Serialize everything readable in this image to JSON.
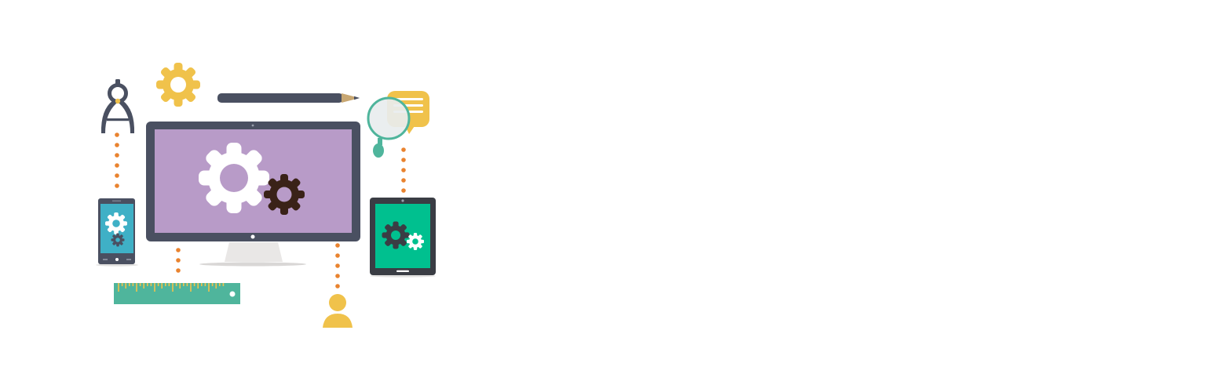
{
  "illustration": {
    "colors": {
      "dark_slate": "#4a5061",
      "monitor_screen": "#b89bc8",
      "gear_yellow": "#f0c24b",
      "dots_orange": "#e9832f",
      "teal": "#4fb59c",
      "phone_screen": "#3fb0c6",
      "tablet_screen": "#00c08f",
      "gear_dark_brown": "#3a2218",
      "pencil_tip": "#c8a772",
      "stand_light": "#e9e7e6",
      "magnifier_lens": "#e8edee",
      "gear_white": "#ffffff"
    },
    "icons": [
      "drafting-compass-icon",
      "gear-icon",
      "pencil-icon",
      "magnifying-glass-icon",
      "chat-bubble-icon",
      "monitor-icon",
      "smartphone-icon",
      "tablet-icon",
      "ruler-icon",
      "user-icon"
    ]
  }
}
